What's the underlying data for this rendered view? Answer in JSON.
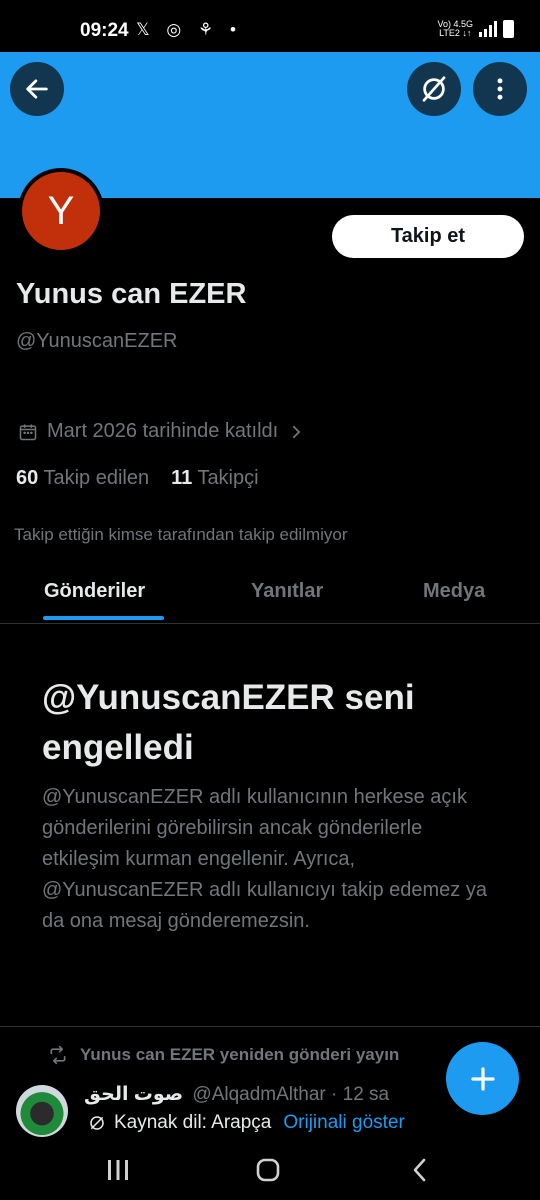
{
  "status_bar": {
    "time": "09:24",
    "network_top": "Vo) 4.5G",
    "network_bottom": "LTE2 ↓↑"
  },
  "profile": {
    "avatar_letter": "Y",
    "avatar_color": "#c1300b",
    "banner_color": "#1d9bf0",
    "follow_label": "Takip et",
    "display_name": "Yunus can EZER",
    "handle": "@YunuscanEZER",
    "joined": "Mart 2026 tarihinde katıldı",
    "following_count": "60",
    "following_label": "Takip edilen",
    "followers_count": "11",
    "followers_label": "Takipçi",
    "not_followed_note": "Takip ettiğin kimse tarafından takip edilmiyor"
  },
  "tabs": [
    {
      "label": "Gönderiler",
      "active": true
    },
    {
      "label": "Yanıtlar",
      "active": false
    },
    {
      "label": "Medya",
      "active": false
    }
  ],
  "blocked": {
    "title": "@YunuscanEZER seni engelledi",
    "body": "@YunuscanEZER adlı kullanıcının herkese açık gönderilerini görebilirsin ancak gönderilerle etkileşim kurman engellenir. Ayrıca, @YunuscanEZER adlı kullanıcıyı takip edemez ya da ona mesaj gönderemezsin."
  },
  "repost": {
    "text": "Yunus can EZER yeniden gönderi yayın",
    "author_name": "صوت الحق",
    "author_handle": "@AlqadmAlthar",
    "time": "· 12 sa",
    "lang_label": "Kaynak dil: Arapça",
    "show_original": "Orijinali göster"
  },
  "icons": {
    "back": "arrow-left-icon",
    "grok": "grok-icon",
    "more": "more-vertical-icon",
    "calendar": "calendar-icon",
    "chevron": "chevron-right-icon",
    "repost": "repost-icon",
    "translate": "translate-icon",
    "compose": "plus-icon"
  }
}
